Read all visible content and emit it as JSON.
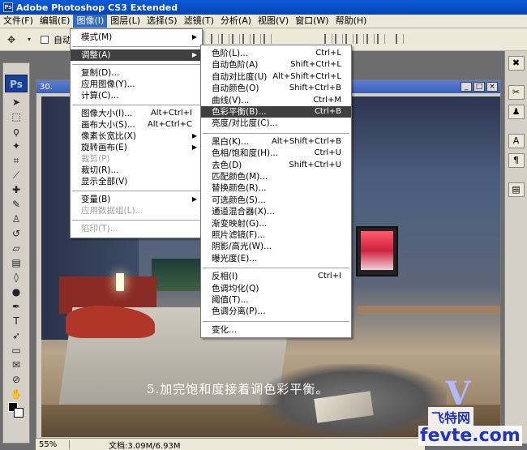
{
  "window": {
    "title": "Adobe Photoshop CS3 Extended",
    "app_icon": "Ps"
  },
  "menubar": [
    {
      "label": "文件(F)",
      "active": false
    },
    {
      "label": "编辑(E)",
      "active": false
    },
    {
      "label": "图像(I)",
      "active": true
    },
    {
      "label": "图层(L)",
      "active": false
    },
    {
      "label": "选择(S)",
      "active": false
    },
    {
      "label": "滤镜(T)",
      "active": false
    },
    {
      "label": "分析(A)",
      "active": false
    },
    {
      "label": "视图(V)",
      "active": false
    },
    {
      "label": "窗口(W)",
      "active": false
    },
    {
      "label": "帮助(H)",
      "active": false
    }
  ],
  "options": {
    "auto_select_label": "自动"
  },
  "toolbox": {
    "logo": "Ps"
  },
  "document": {
    "title": "30.",
    "caption": "5.加完饱和度接着调色彩平衡。"
  },
  "image_menu": [
    {
      "label": "模式(M)",
      "submenu": true
    },
    {
      "sep": true
    },
    {
      "label": "调整(A)",
      "submenu": true,
      "highlight": true
    },
    {
      "sep": true
    },
    {
      "label": "复制(D)..."
    },
    {
      "label": "应用图像(Y)..."
    },
    {
      "label": "计算(C)..."
    },
    {
      "sep": true
    },
    {
      "label": "图像大小(I)...",
      "shortcut": "Alt+Ctrl+I"
    },
    {
      "label": "画布大小(S)...",
      "shortcut": "Alt+Ctrl+C"
    },
    {
      "label": "像素长宽比(X)",
      "submenu": true
    },
    {
      "label": "旋转画布(E)",
      "submenu": true
    },
    {
      "label": "裁剪(P)",
      "disabled": true
    },
    {
      "label": "裁切(R)..."
    },
    {
      "label": "显示全部(V)"
    },
    {
      "sep": true
    },
    {
      "label": "变量(B)",
      "submenu": true
    },
    {
      "label": "应用数据组(L)...",
      "disabled": true
    },
    {
      "sep": true
    },
    {
      "label": "陷印(T)...",
      "disabled": true
    }
  ],
  "adjust_menu": [
    {
      "label": "色阶(L)...",
      "shortcut": "Ctrl+L"
    },
    {
      "label": "自动色阶(A)",
      "shortcut": "Shift+Ctrl+L"
    },
    {
      "label": "自动对比度(U)",
      "shortcut": "Alt+Shift+Ctrl+L"
    },
    {
      "label": "自动颜色(O)",
      "shortcut": "Shift+Ctrl+B"
    },
    {
      "label": "曲线(V)...",
      "shortcut": "Ctrl+M"
    },
    {
      "label": "色彩平衡(B)...",
      "shortcut": "Ctrl+B",
      "highlight": true
    },
    {
      "label": "亮度/对比度(C)..."
    },
    {
      "sep": true
    },
    {
      "label": "黑白(K)...",
      "shortcut": "Alt+Shift+Ctrl+B"
    },
    {
      "label": "色相/饱和度(H)...",
      "shortcut": "Ctrl+U"
    },
    {
      "label": "去色(D)",
      "shortcut": "Shift+Ctrl+U"
    },
    {
      "label": "匹配颜色(M)..."
    },
    {
      "label": "替换颜色(R)..."
    },
    {
      "label": "可选颜色(S)..."
    },
    {
      "label": "通道混合器(X)..."
    },
    {
      "label": "渐变映射(G)..."
    },
    {
      "label": "照片滤镜(F)..."
    },
    {
      "label": "阴影/高光(W)..."
    },
    {
      "label": "曝光度(E)..."
    },
    {
      "sep": true
    },
    {
      "label": "反相(I)",
      "shortcut": "Ctrl+I"
    },
    {
      "label": "色调均化(Q)"
    },
    {
      "label": "阈值(T)..."
    },
    {
      "label": "色调分离(P)..."
    },
    {
      "sep": true
    },
    {
      "label": "变化..."
    }
  ],
  "statusbar": {
    "zoom": "55%",
    "doc_info": "文档:3.09M/6.93M"
  },
  "watermark": {
    "logo_letter": "V",
    "cn": "飞特网",
    "en": "fevte.com"
  }
}
